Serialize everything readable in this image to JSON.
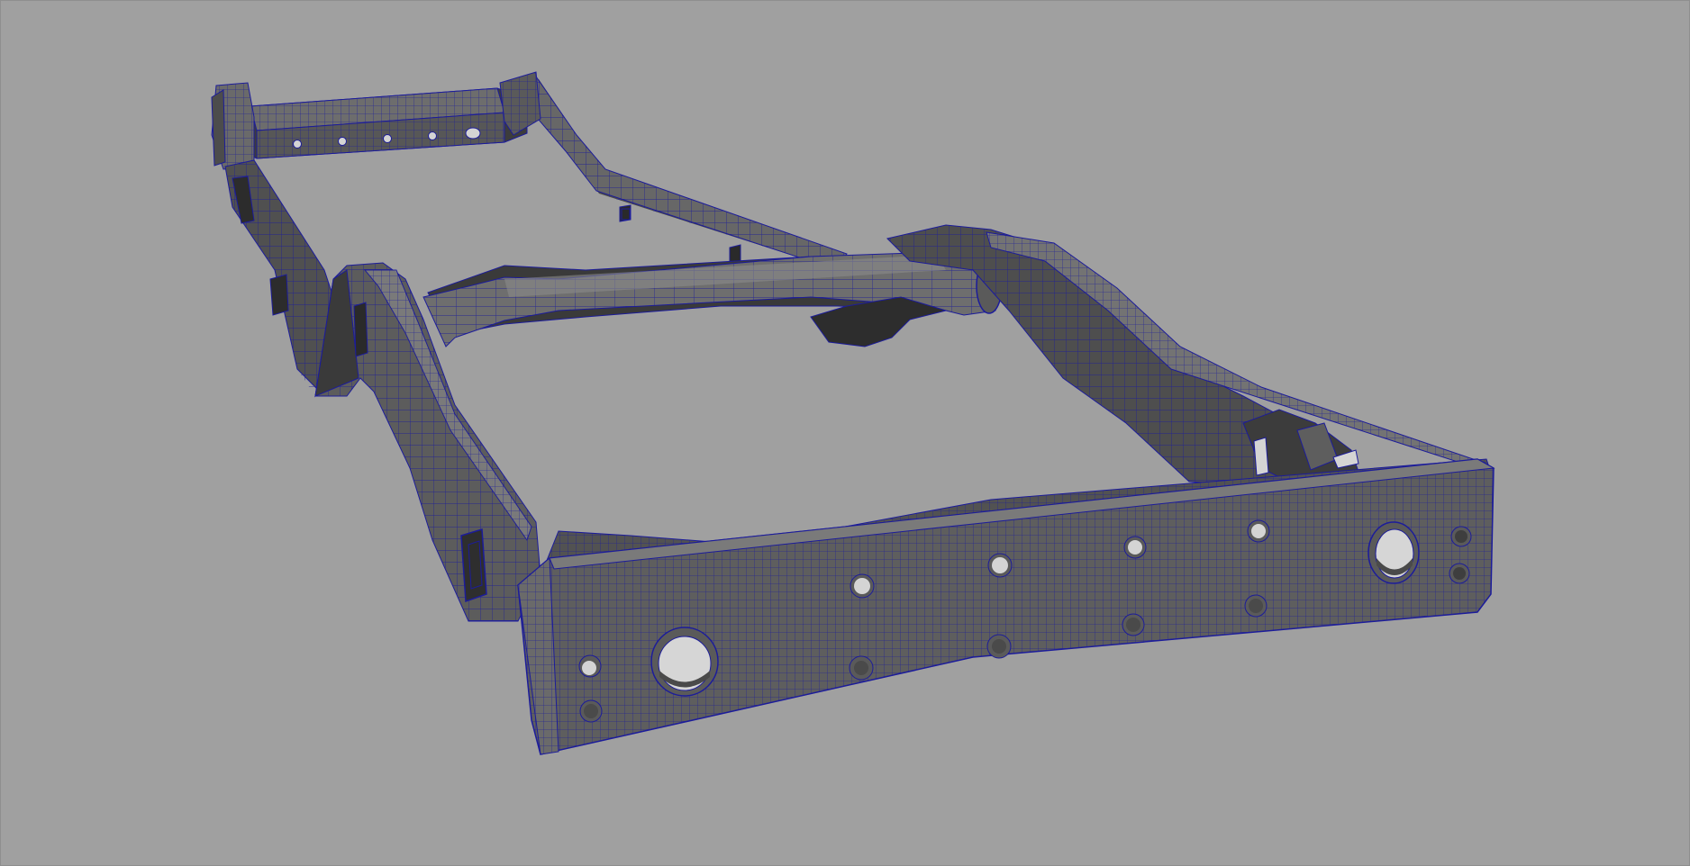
{
  "viewport": {
    "background_color": "#a0a0a0",
    "mesh_fill_color": "#5f5f5f",
    "mesh_fill_light_color": "#777777",
    "mesh_fill_dark_color": "#3f3f3f",
    "wireframe_color": "#1c1c9a",
    "hole_color": "#d4d4d4",
    "shading_mode": "wireframe-on-shaded",
    "object": "chassis-frame-model"
  }
}
